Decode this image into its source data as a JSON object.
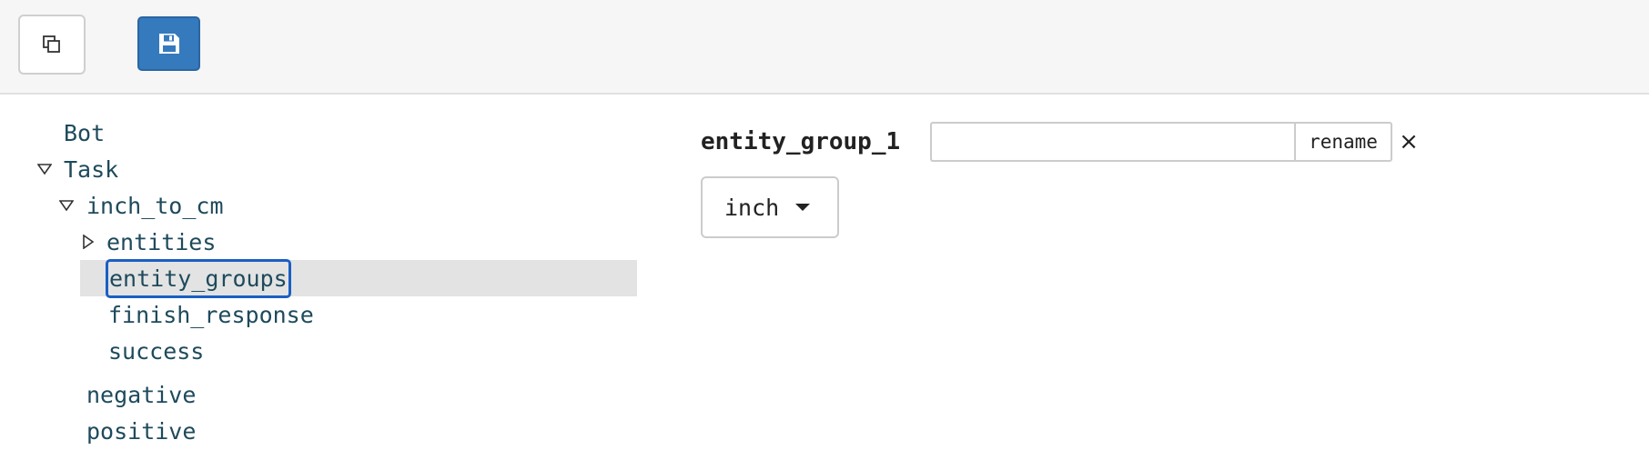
{
  "toolbar": {
    "copy_icon": "copy-icon",
    "save_icon": "floppy-disk-icon",
    "save_color": "#357abd"
  },
  "tree": {
    "root_bot": "Bot",
    "task": "Task",
    "task_child": "inch_to_cm",
    "children": {
      "entities": "entities",
      "entity_groups": "entity_groups",
      "finish_response": "finish_response",
      "success": "success"
    },
    "negative": "negative",
    "positive": "positive",
    "selected_color": "#1a5fc4"
  },
  "detail": {
    "group_name": "entity_group_1",
    "rename_value": "",
    "rename_button": "rename",
    "close_label": "×",
    "dropdown_value": "inch"
  }
}
